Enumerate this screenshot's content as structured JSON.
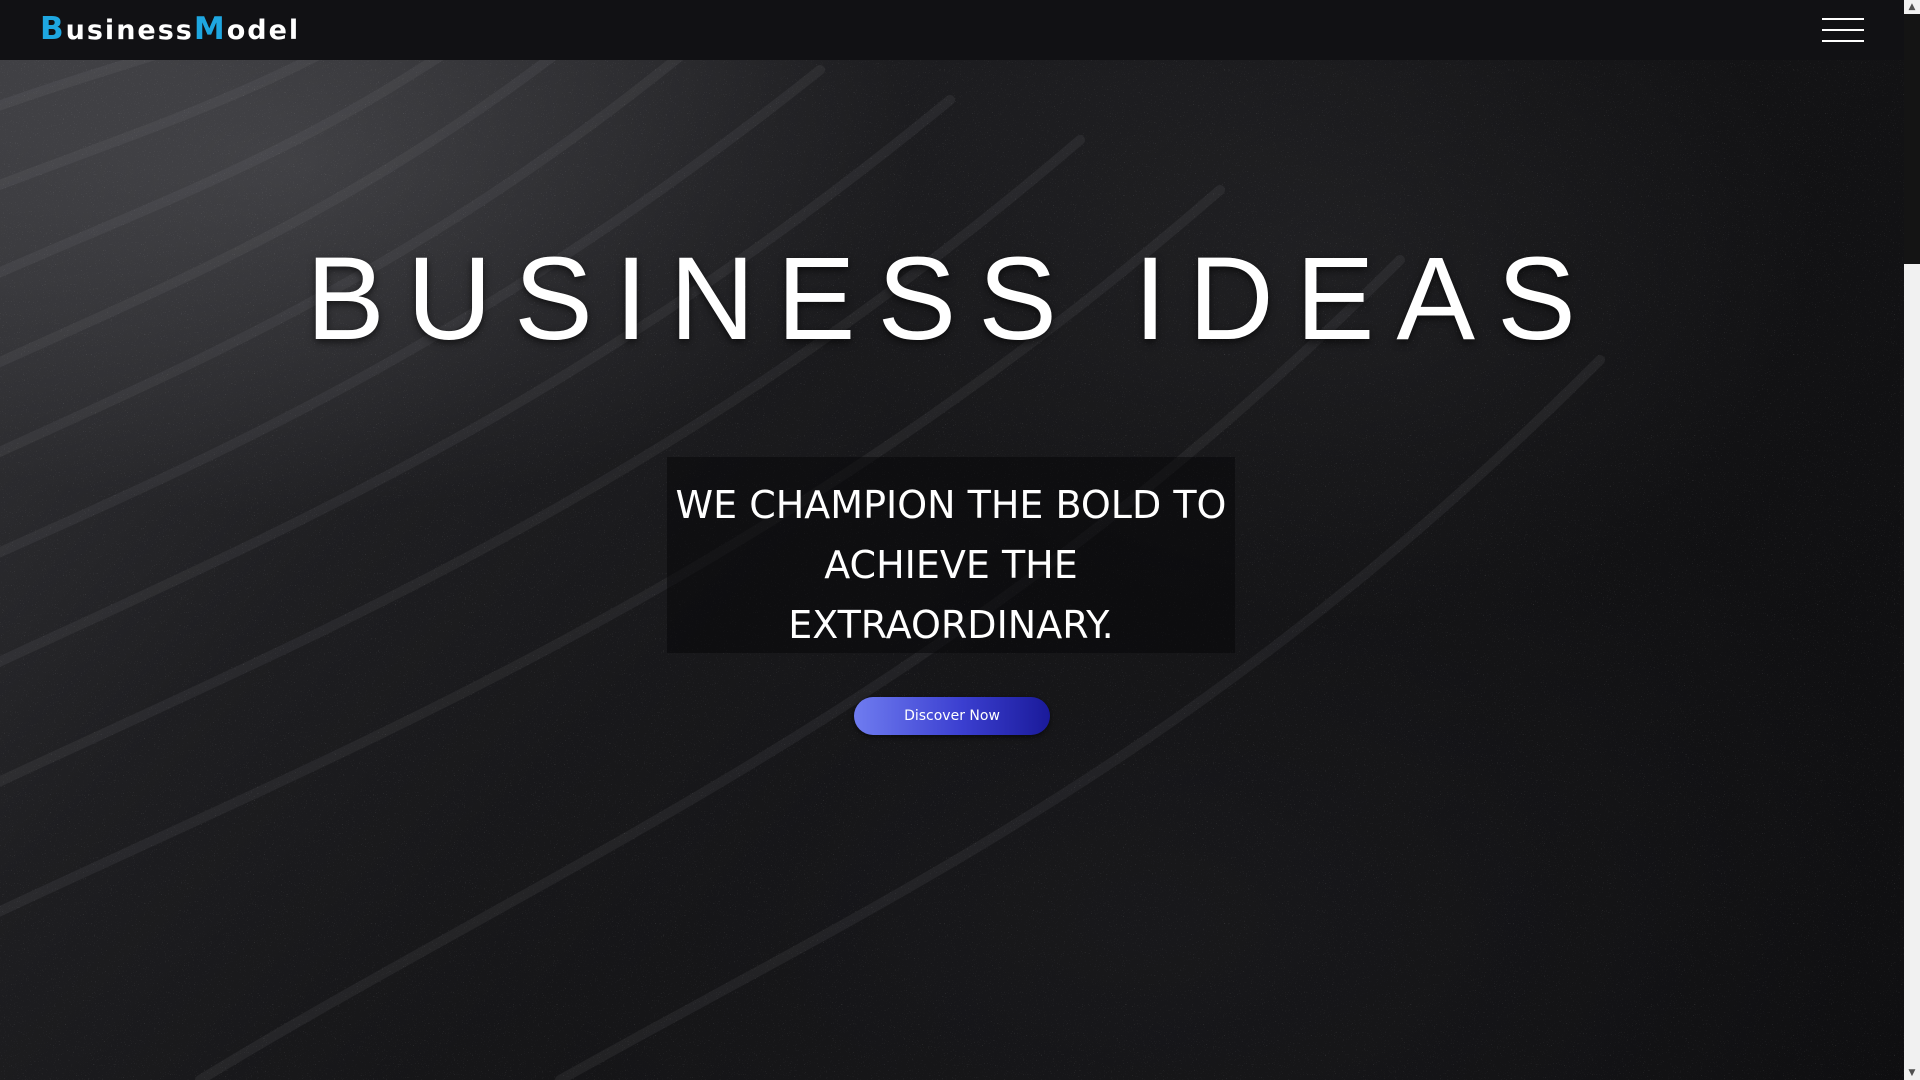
{
  "header": {
    "logo": {
      "first_initial": "B",
      "first_rest": "usiness",
      "second_initial": "M",
      "second_rest": "odel"
    },
    "menu_icon": "hamburger-menu-icon"
  },
  "hero": {
    "headline": "BUSINESS IDEAS",
    "tagline_lines": [
      "WE CHAMPION THE BOLD TO",
      "ACHIEVE THE",
      "EXTRAORDINARY."
    ],
    "cta_label": "Discover Now"
  },
  "scrollbar": {
    "up_icon": "arrow-up-icon",
    "down_icon": "arrow-down-icon"
  },
  "colors": {
    "accent": "#1ea7e1",
    "header_bg": "#111114",
    "button_gradient_start": "#6f7cf0",
    "button_gradient_end": "#1a1a9a"
  }
}
